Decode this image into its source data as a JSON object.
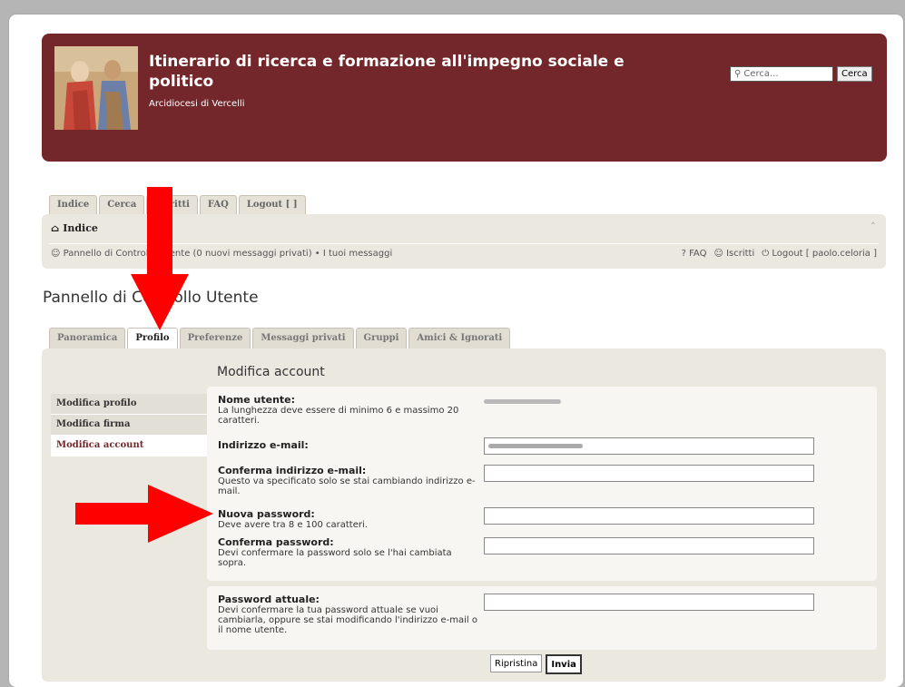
{
  "header": {
    "title": "Itinerario di ricerca e formazione all'impegno sociale e politico",
    "description": "Arcidiocesi di Vercelli",
    "search_placeholder": "Cerca...",
    "search_button": "Cerca"
  },
  "top_tabs": [
    "Indice",
    "Cerca",
    "Iscritti",
    "FAQ",
    "Logout [ ]"
  ],
  "nav": {
    "breadcrumb": "Indice",
    "ucp_line": "Pannello di Controllo Utente (0 nuovi messaggi privati) • I tuoi messaggi",
    "right_faq": "FAQ",
    "right_members": "Iscritti",
    "right_logout": "Logout [ paolo.celoria ]"
  },
  "page_title": "Pannello di Controllo Utente",
  "ucp_tabs": [
    "Panoramica",
    "Profilo",
    "Preferenze",
    "Messaggi privati",
    "Gruppi",
    "Amici & Ignorati"
  ],
  "panel_title": "Modifica account",
  "sidebar": [
    "Modifica profilo",
    "Modifica firma",
    "Modifica account"
  ],
  "form": {
    "username_label": "Nome utente:",
    "username_hint": "La lunghezza deve essere di minimo 6 e massimo 20 caratteri.",
    "email_label": "Indirizzo e-mail:",
    "confirm_email_label": "Conferma indirizzo e-mail:",
    "confirm_email_hint": "Questo va specificato solo se stai cambiando indirizzo e-mail.",
    "new_password_label": "Nuova password:",
    "new_password_hint": "Deve avere tra 8 e 100 caratteri.",
    "confirm_password_label": "Conferma password:",
    "confirm_password_hint": "Devi confermare la password solo se l'hai cambiata sopra.",
    "current_password_label": "Password attuale:",
    "current_password_hint": "Devi confermare la tua password attuale se vuoi cambiarla, oppure se stai modificando l'indirizzo e-mail o il nome utente."
  },
  "buttons": {
    "reset": "Ripristina",
    "submit": "Invia"
  },
  "colors": {
    "brand": "#73272a",
    "arrow": "#ff0000"
  }
}
